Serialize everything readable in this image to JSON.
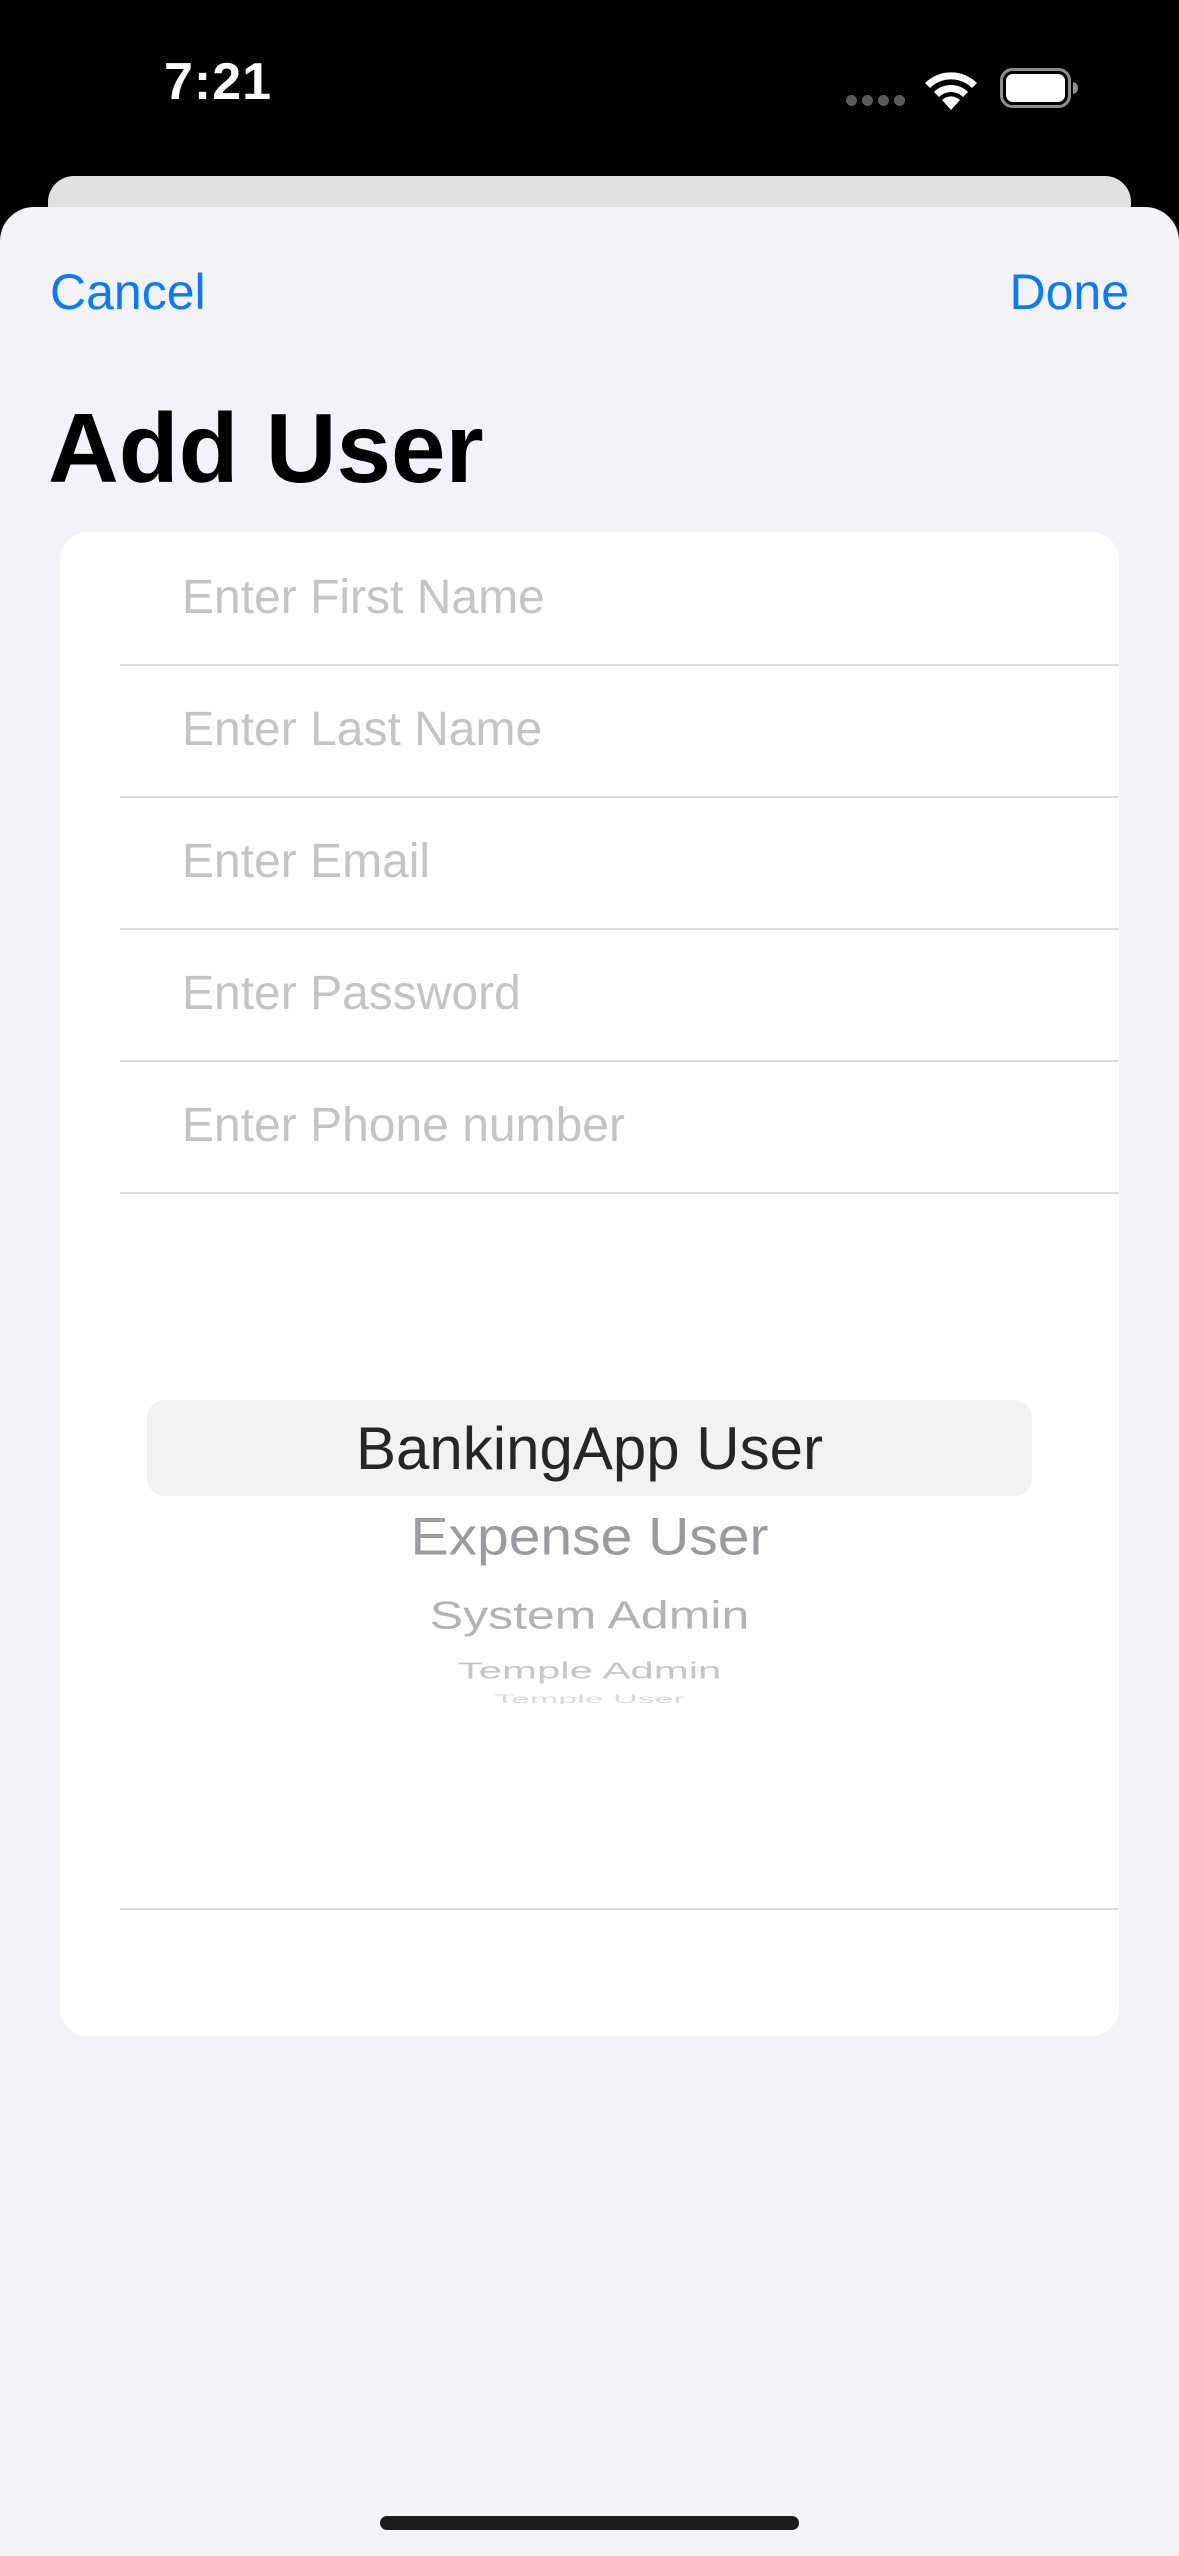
{
  "status_bar": {
    "time": "7:21"
  },
  "nav": {
    "cancel_label": "Cancel",
    "done_label": "Done"
  },
  "title": "Add User",
  "form": {
    "fields": [
      {
        "placeholder": "Enter First Name",
        "value": ""
      },
      {
        "placeholder": "Enter Last Name",
        "value": ""
      },
      {
        "placeholder": "Enter Email",
        "value": ""
      },
      {
        "placeholder": "Enter Password",
        "value": ""
      },
      {
        "placeholder": "Enter Phone number",
        "value": ""
      }
    ],
    "role_picker": {
      "selected": "BankingApp User",
      "options": [
        "BankingApp User",
        "Expense User",
        "System Admin",
        "Temple Admin",
        "Temple User"
      ]
    }
  },
  "colors": {
    "accent": "#0a7aff",
    "sheet_background": "#f2f2f7",
    "card_background": "#ffffff",
    "placeholder": "#c4c4c6"
  },
  "icons": [
    "cellular-signal-icon",
    "wifi-icon",
    "battery-icon"
  ]
}
